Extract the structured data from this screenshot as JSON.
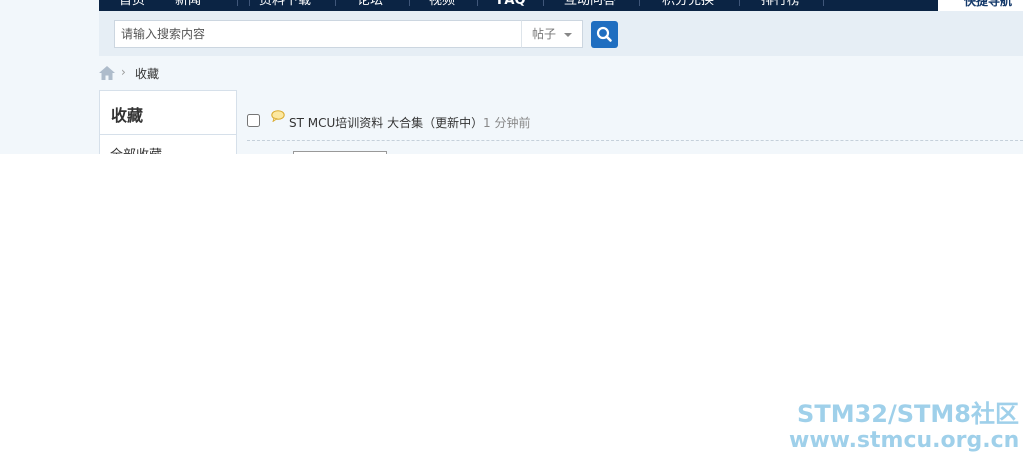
{
  "nav": {
    "items": [
      {
        "label": "首页"
      },
      {
        "label": "新闻"
      },
      {
        "label": "资料下载"
      },
      {
        "label": "论坛"
      },
      {
        "label": "视频"
      },
      {
        "label": "FAQ"
      },
      {
        "label": "互动问答"
      },
      {
        "label": "积分兑换"
      },
      {
        "label": "排行榜"
      }
    ],
    "quick_nav": "快捷导航"
  },
  "search": {
    "placeholder": "请输入搜索内容",
    "type_label": "帖子"
  },
  "breadcrumb": {
    "separator": "›",
    "current": "收藏"
  },
  "sidebar": {
    "title": "收藏",
    "items": [
      {
        "label": "全部收藏"
      }
    ]
  },
  "favorites": {
    "items": [
      {
        "title": "ST MCU培训资料 大合集（更新中）",
        "time": "1 分钟前"
      }
    ]
  },
  "watermark": {
    "line1": "STM32/STM8社区",
    "line2": "www.stmcu.org.cn"
  },
  "colors": {
    "nav_bg": "#0b2444",
    "accent": "#1f6ec0",
    "page_bg": "#f2f7fb",
    "watermark": "#9fd0ea"
  }
}
